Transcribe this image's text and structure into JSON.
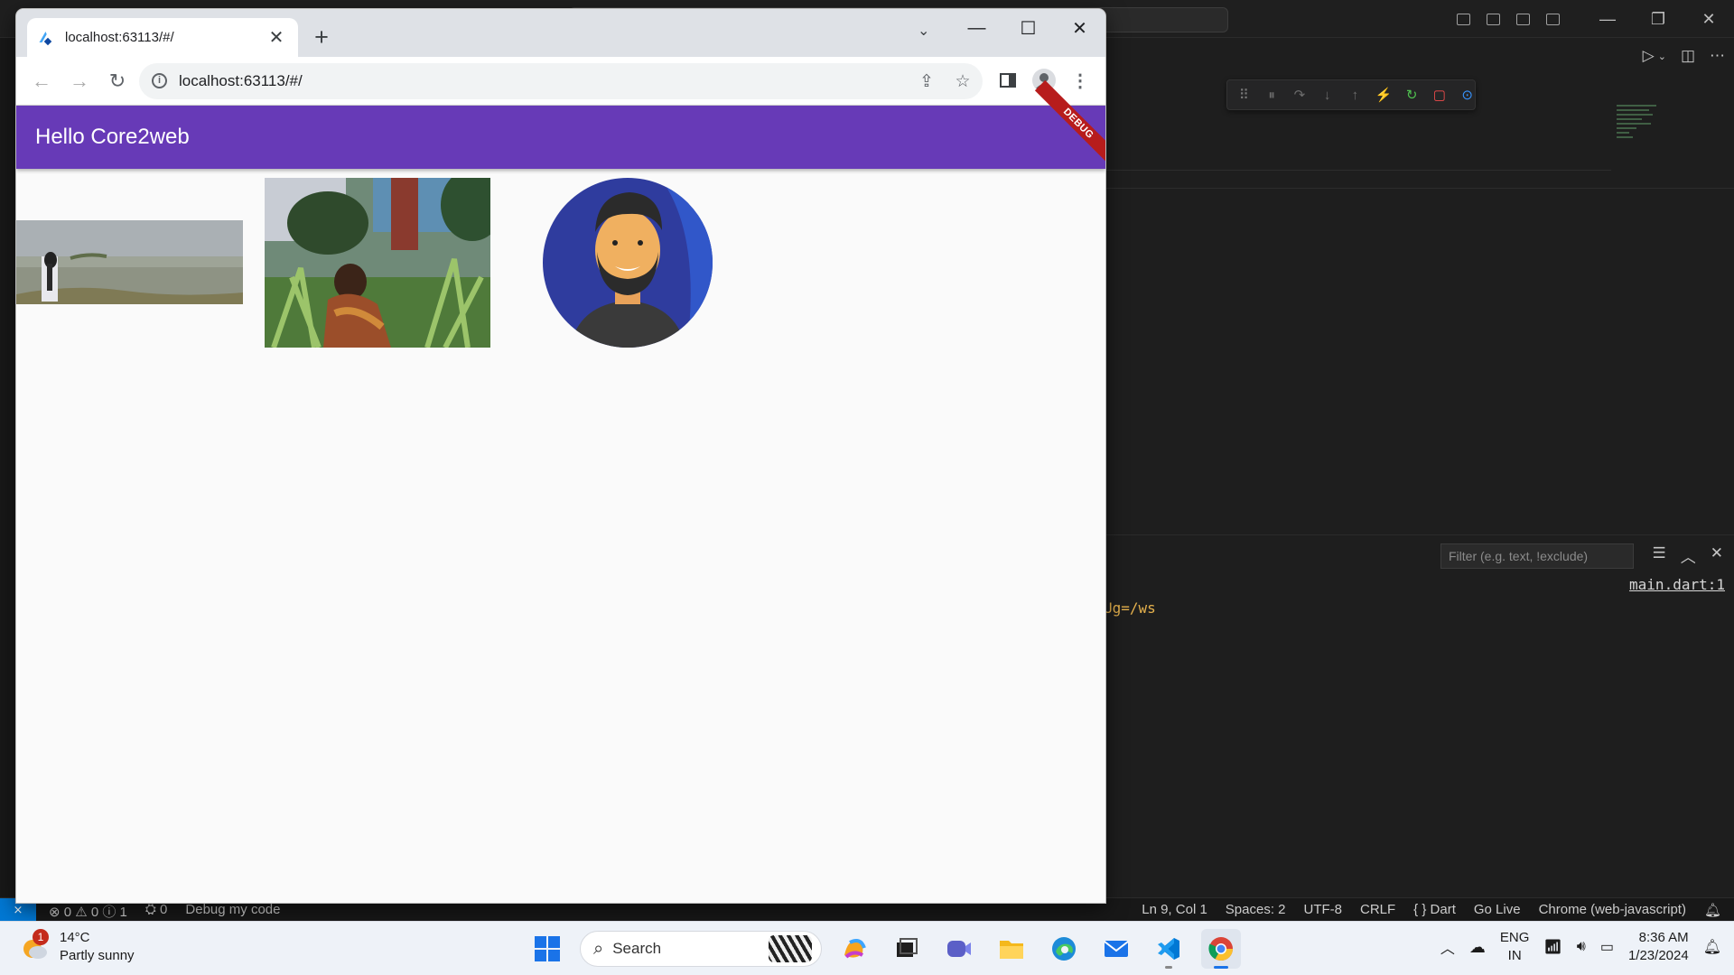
{
  "browser": {
    "tab_title": "localhost:63113/#/",
    "tab_close": "✕",
    "new_tab": "+",
    "url": "localhost:63113/#/"
  },
  "app": {
    "title": "Hello Core2web",
    "debug_banner": "DEBUG"
  },
  "vscode": {
    "panel_filter_placeholder": "Filter (e.g. text, !exclude)",
    "source_link": "main.dart:1",
    "output_line": "Ug=/ws",
    "status_left": {
      "problems": "⊗ 0 ⚠ 0 ⓘ 1",
      "ports": "⛭ 0",
      "debug": "Debug my code"
    },
    "status_right": {
      "position": "Ln 9, Col 1",
      "spaces": "Spaces: 2",
      "encoding": "UTF-8",
      "eol": "CRLF",
      "language": "{ } Dart",
      "go_live": "Go Live",
      "debugger": "Chrome (web-javascript)"
    }
  },
  "taskbar": {
    "weather_badge": "1",
    "temperature": "14°C",
    "condition": "Partly sunny",
    "search_label": "Search",
    "lang_line1": "ENG",
    "lang_line2": "IN",
    "time": "8:36 AM",
    "date": "1/23/2024"
  },
  "colors": {
    "appbar": "#673ab7",
    "debug_banner": "#b71c1c",
    "vscode_remote": "#0078d4"
  }
}
